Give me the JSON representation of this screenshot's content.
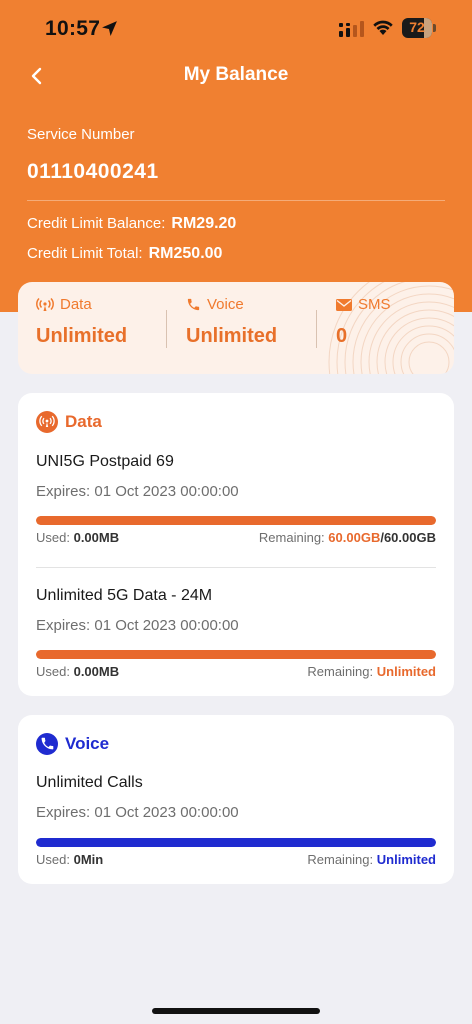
{
  "status": {
    "time": "10:57",
    "battery": "72",
    "battery_level": 0.72
  },
  "colors": {
    "brand_orange": "#f08031",
    "data_orange": "#e8692d",
    "voice_blue": "#1f2bd0"
  },
  "header": {
    "title": "My Balance",
    "back_icon": "chevron-left-icon"
  },
  "account": {
    "service_label": "Service Number",
    "service_number": "01110400241",
    "credit_balance_label": "Credit Limit Balance:",
    "credit_balance_value": "RM29.20",
    "credit_total_label": "Credit Limit Total:",
    "credit_total_value": "RM250.00"
  },
  "summary": {
    "items": [
      {
        "label": "Data",
        "value": "Unlimited",
        "icon": "signal-broadcast-icon"
      },
      {
        "label": "Voice",
        "value": "Unlimited",
        "icon": "phone-icon"
      },
      {
        "label": "SMS",
        "value": "0",
        "icon": "mail-icon"
      }
    ]
  },
  "data_card": {
    "title": "Data",
    "plans": [
      {
        "name": "UNI5G Postpaid 69",
        "expires": "Expires: 01 Oct 2023 00:00:00",
        "used_label": "Used:",
        "used_value": "0.00MB",
        "remaining_label": "Remaining:",
        "remaining_value": "60.00GB",
        "remaining_total": "/60.00GB",
        "remaining_fraction": 1.0
      },
      {
        "name": "Unlimited 5G Data - 24M",
        "expires": "Expires: 01 Oct 2023 00:00:00",
        "used_label": "Used:",
        "used_value": "0.00MB",
        "remaining_label": "Remaining:",
        "remaining_value": "Unlimited",
        "remaining_fraction": 1.0
      }
    ]
  },
  "voice_card": {
    "title": "Voice",
    "plans": [
      {
        "name": "Unlimited Calls",
        "expires": "Expires: 01 Oct 2023 00:00:00",
        "used_label": "Used:",
        "used_value": "0Min",
        "remaining_label": "Remaining:",
        "remaining_value": "Unlimited",
        "remaining_fraction": 1.0
      }
    ]
  }
}
